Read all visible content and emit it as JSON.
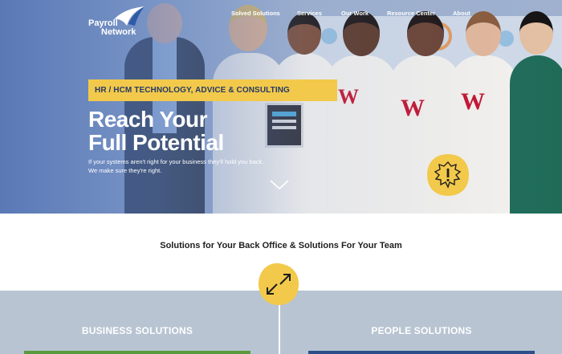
{
  "brand": {
    "logo_line1": "Payroll",
    "logo_line2": "Network",
    "logo_icon": "swoosh-logo-icon"
  },
  "nav": {
    "items": [
      {
        "label": "Solved Solutions"
      },
      {
        "label": "Services"
      },
      {
        "label": "Our Work"
      },
      {
        "label": "Resource Center"
      },
      {
        "label": "About"
      }
    ]
  },
  "hero": {
    "tagline": "HR / HCM TECHNOLOGY, ADVICE & CONSULTING",
    "headline_line1": "Reach Your",
    "headline_line2": "Full Potential",
    "subtext_line1": "If your systems aren't right for your business they'll hold you back.",
    "subtext_line2": "We make sure they're right.",
    "scroll_icon": "chevron-down-icon",
    "badge_icon": "exclamation-badge-icon"
  },
  "solutions": {
    "heading": "Solutions for Your Back Office & Solutions For Your Team",
    "icon": "swap-arrows-icon",
    "columns": [
      {
        "title": "BUSINESS SOLUTIONS"
      },
      {
        "title": "PEOPLE SOLUTIONS"
      }
    ]
  },
  "colors": {
    "accent_yellow": "#f3c94b",
    "navy": "#243a66",
    "band_gray": "#b8c4d2",
    "green": "#5a9a3e",
    "blue": "#2c4f8a"
  }
}
